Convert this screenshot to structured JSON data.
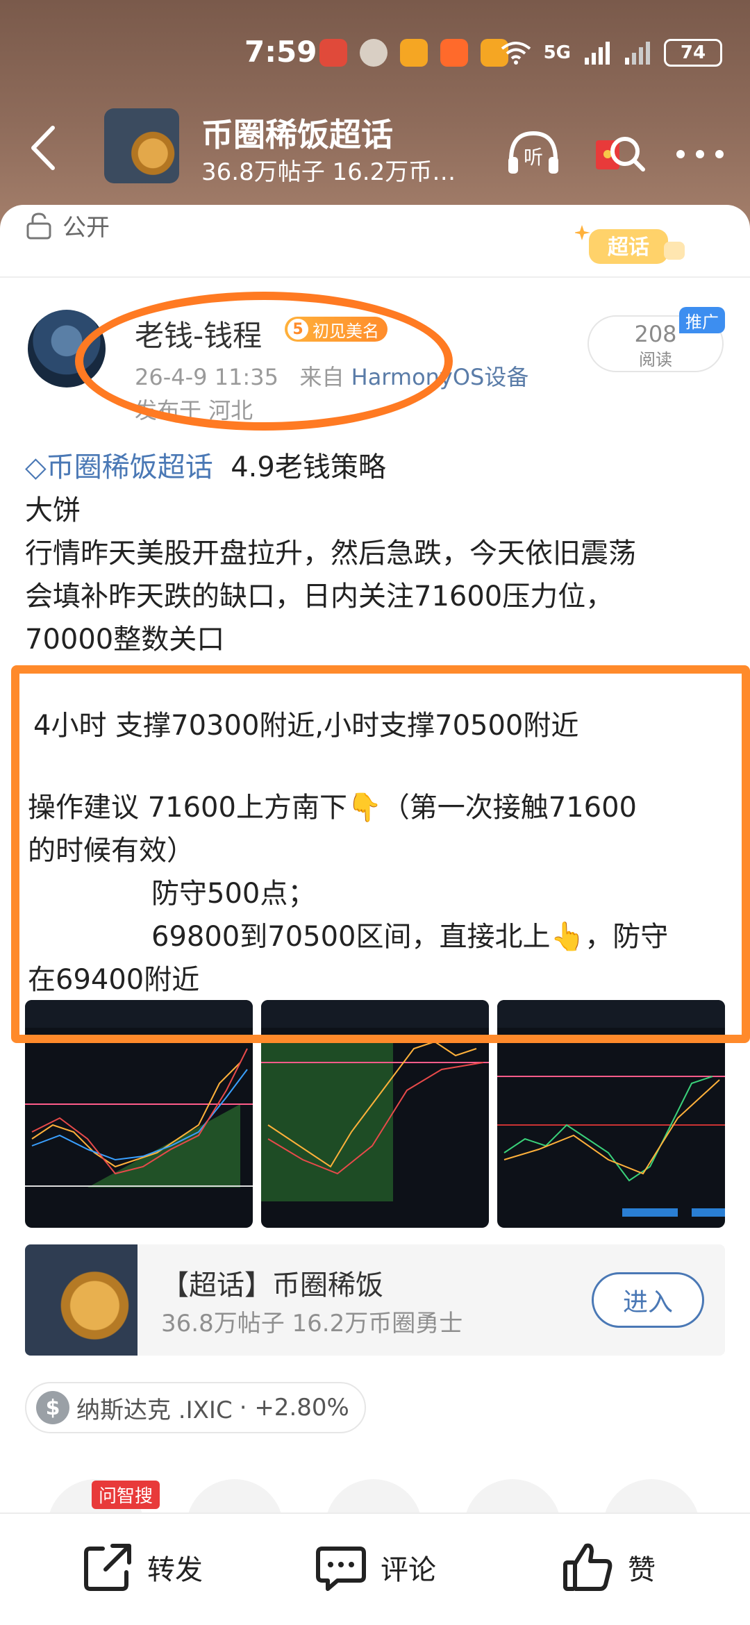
{
  "status_bar": {
    "time": "7:59",
    "network": "5G",
    "battery": "74"
  },
  "header": {
    "title": "币圈稀饭超话",
    "subtitle": "36.8万帖子 16.2万币…"
  },
  "visibility": "公开",
  "chaohua_badge": "超话",
  "author": {
    "name": "老钱-钱程",
    "level": "5",
    "badge_text": "初见美名",
    "date": "26-4-9 11:35",
    "source_prefix": "来自",
    "device": "HarmonyOS设备",
    "location": "发布于 河北"
  },
  "views": {
    "count": "208",
    "label": "阅读",
    "promo": "推广"
  },
  "post": {
    "topic": "币圈稀饭超话",
    "topic_title": "4.9老钱策略",
    "lines": [
      "大饼",
      "行情昨天美股开盘拉升，然后急跌，今天依旧震荡",
      "会填补昨天跌的缺口，日内关注71600压力位，",
      "70000整数关口"
    ],
    "box_lines": [
      "4小时 支撑70300附近,小时支撑70500附近",
      "操作建议  71600上方南下👇（第一次接触71600",
      "的时候有效）",
      "防守500点；",
      "69800到70500区间，直接北上👆，防守",
      "在69400附近"
    ]
  },
  "group_card": {
    "title": "【超话】币圈稀饭",
    "subtitle": "36.8万帖子 16.2万币圈勇士",
    "button": "进入"
  },
  "stock_chip": {
    "symbol": "$",
    "name": "纳斯达克 .IXIC",
    "change": "· +2.80%"
  },
  "ask_tag": "问智搜",
  "bottom_bar": {
    "repost": "转发",
    "comment": "评论",
    "like": "赞"
  },
  "colors": {
    "highlight": "#ff7a22",
    "link": "#4a78b5",
    "header_bg": "#8f6c5b"
  }
}
